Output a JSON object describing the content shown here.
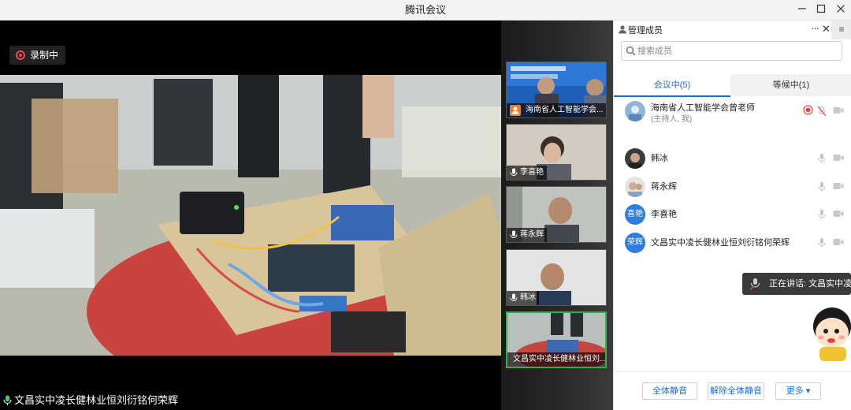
{
  "window": {
    "title": "腾讯会议",
    "min_icon": "minimize-icon",
    "max_icon": "maximize-icon",
    "close_icon": "close-icon"
  },
  "main_video": {
    "recording_label": "录制中",
    "speaker_name": "文昌实中凌长健林业恒刘衍铭何荣辉"
  },
  "thumbnails": [
    {
      "name": "海南省人工智能学会...",
      "role": "host"
    },
    {
      "name": "李喜艳"
    },
    {
      "name": "蒋永辉"
    },
    {
      "name": "韩冰"
    },
    {
      "name": "文昌实中凌长健林业恒刘...",
      "active": true
    }
  ],
  "panel": {
    "title": "管理成员",
    "more_label": "···",
    "close_label": "✕",
    "toggle_label": "≡",
    "search_placeholder": "搜索成员",
    "tabs": {
      "in_meeting": "会议中(5)",
      "waiting": "等候中(1)"
    },
    "members": [
      {
        "name": "海南省人工智能学会曾老师",
        "sub": "(主持人, 我)",
        "avatar": "photo",
        "recording": true
      },
      {
        "name": "韩冰",
        "avatar": "photo"
      },
      {
        "name": "蒋永辉",
        "avatar": "photo"
      },
      {
        "name": "李喜艳",
        "avatar": "initials",
        "initials": "喜艳"
      },
      {
        "name": "文昌实中凌长健林业恒刘衍铭何荣辉",
        "avatar": "initials",
        "initials": "荣辉"
      }
    ],
    "speaking_label": "正在讲话: 文昌实中凌长",
    "buttons": {
      "mute_all": "全体静音",
      "unmute_all": "解除全体静音",
      "more": "更多 ▾"
    }
  },
  "colors": {
    "accent": "#1a6fe0",
    "recording_red": "#e84a4a",
    "active_green": "#2bb24c",
    "host_orange": "#f07b22"
  }
}
